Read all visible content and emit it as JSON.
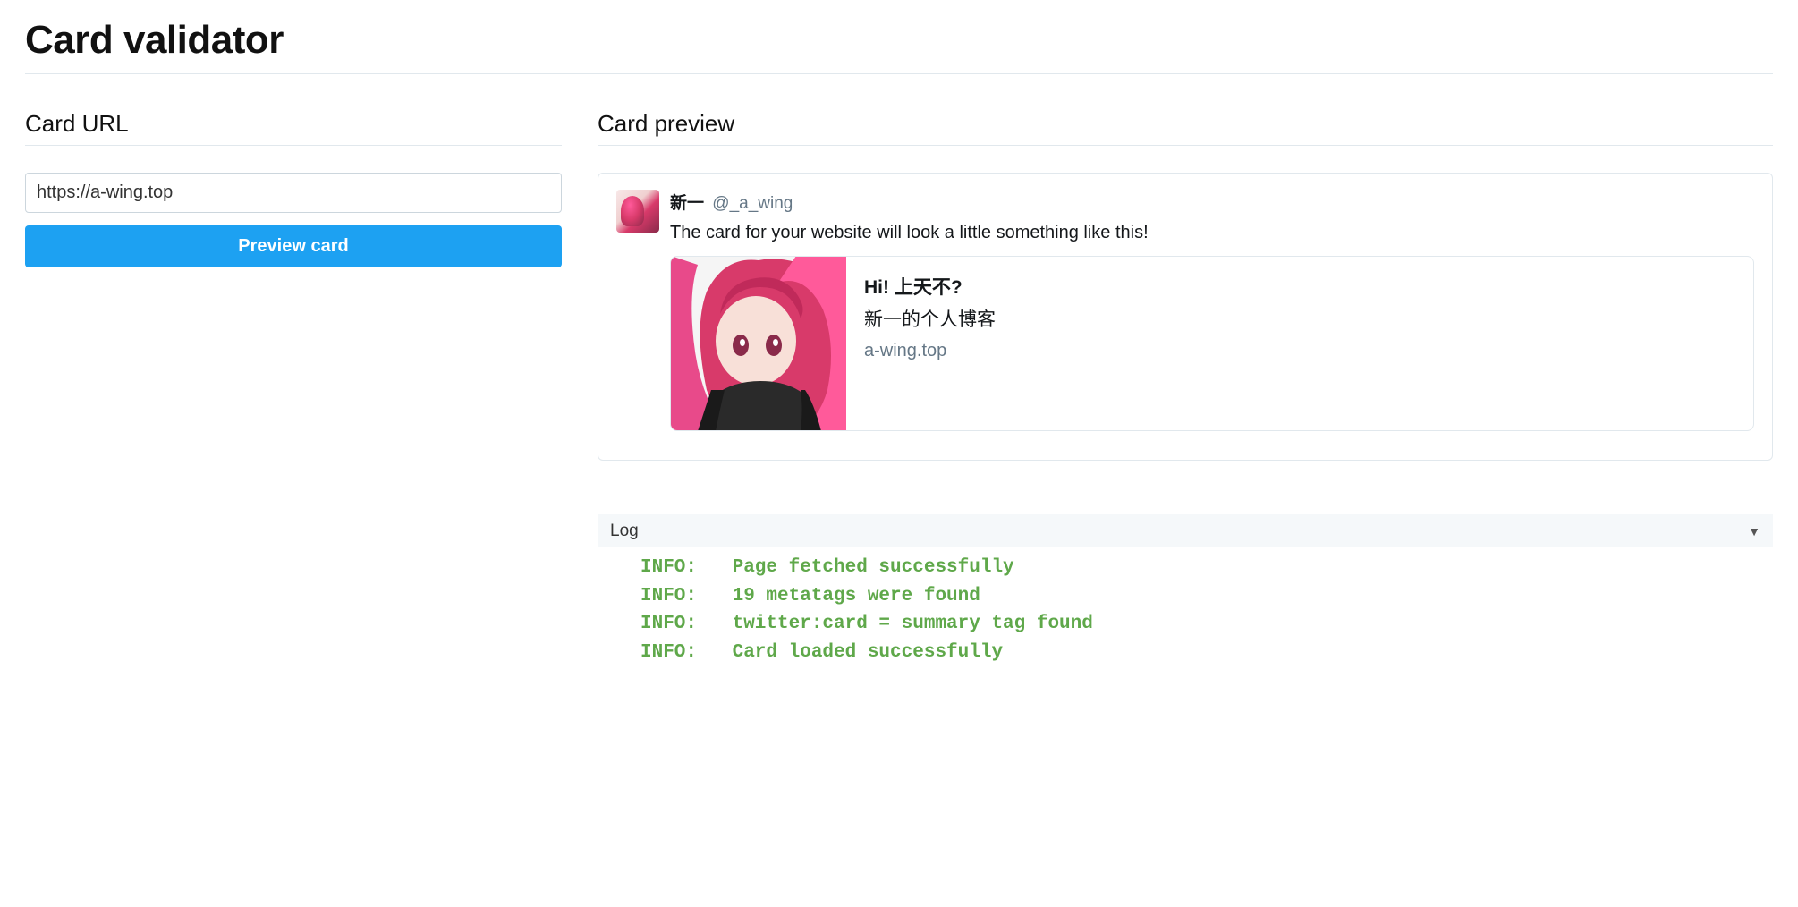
{
  "page": {
    "title": "Card validator"
  },
  "left": {
    "section_title": "Card URL",
    "url_value": "https://a-wing.top",
    "preview_button": "Preview card"
  },
  "right": {
    "section_title": "Card preview",
    "tweet": {
      "author_name": "新一",
      "author_handle": "@_a_wing",
      "text": "The card for your website will look a little something like this!"
    },
    "card": {
      "title": "Hi! 上天不?",
      "description": "新一的个人博客",
      "domain": "a-wing.top"
    }
  },
  "log": {
    "header": "Log",
    "lines": [
      {
        "level": "INFO:",
        "msg": "Page fetched successfully"
      },
      {
        "level": "INFO:",
        "msg": "19 metatags were found"
      },
      {
        "level": "INFO:",
        "msg": "twitter:card = summary tag found"
      },
      {
        "level": "INFO:",
        "msg": "Card loaded successfully"
      }
    ]
  }
}
